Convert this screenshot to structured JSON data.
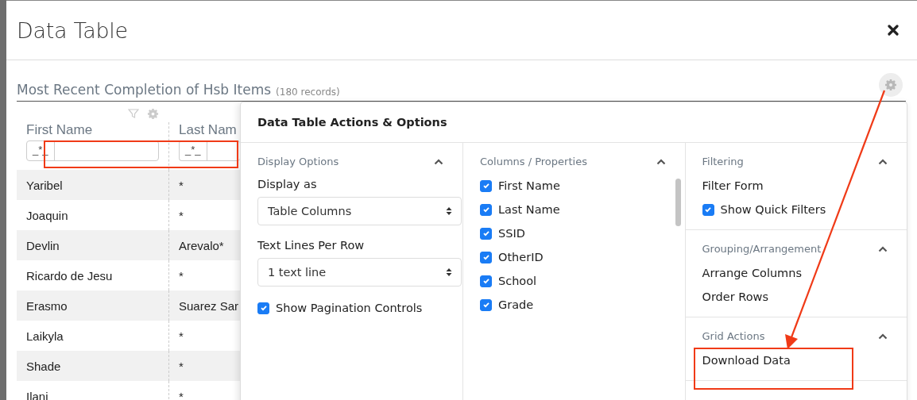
{
  "window": {
    "title": "Data Table"
  },
  "table": {
    "title": "Most Recent Completion of Hsb Items",
    "record_count": "(180 records)",
    "columns": [
      {
        "label": "First Name",
        "filter_prefix": "_*_"
      },
      {
        "label": "Last Nam",
        "filter_prefix": "_*_"
      }
    ],
    "rows": [
      {
        "cells": [
          "Yaribel",
          "*"
        ]
      },
      {
        "cells": [
          "Joaquin",
          "*"
        ]
      },
      {
        "cells": [
          "Devlin",
          "Arevalo*"
        ]
      },
      {
        "cells": [
          "Ricardo de Jesu",
          "*"
        ]
      },
      {
        "cells": [
          "Erasmo",
          "Suarez Sar"
        ]
      },
      {
        "cells": [
          "Laikyla",
          "*"
        ]
      },
      {
        "cells": [
          "Shade",
          "*"
        ]
      },
      {
        "cells": [
          "Ilani",
          "*"
        ]
      }
    ]
  },
  "options_panel": {
    "title": "Data Table Actions & Options",
    "columns": [
      [
        {
          "title": "Display Options",
          "expanded": true,
          "items": [
            {
              "kind": "label",
              "text": "Display as"
            },
            {
              "kind": "select",
              "value": "Table Columns"
            },
            {
              "kind": "label",
              "text": "Text Lines Per Row"
            },
            {
              "kind": "select",
              "value": "1 text line"
            },
            {
              "kind": "checkbox",
              "text": "Show Pagination Controls",
              "checked": true
            }
          ]
        }
      ],
      [
        {
          "title": "Columns / Properties",
          "expanded": true,
          "scroll": true,
          "items": [
            {
              "kind": "checkbox",
              "text": "First Name",
              "checked": true
            },
            {
              "kind": "checkbox",
              "text": "Last Name",
              "checked": true
            },
            {
              "kind": "checkbox",
              "text": "SSID",
              "checked": true
            },
            {
              "kind": "checkbox",
              "text": "OtherID",
              "checked": true
            },
            {
              "kind": "checkbox",
              "text": "School",
              "checked": true
            },
            {
              "kind": "checkbox",
              "text": "Grade",
              "checked": true
            }
          ]
        }
      ],
      [
        {
          "title": "Filtering",
          "expanded": true,
          "items": [
            {
              "kind": "action",
              "text": "Filter Form"
            },
            {
              "kind": "checkbox",
              "text": "Show Quick Filters",
              "checked": true
            }
          ]
        },
        {
          "title": "Grouping/Arrangement",
          "expanded": true,
          "items": [
            {
              "kind": "action",
              "text": "Arrange Columns"
            },
            {
              "kind": "action",
              "text": "Order Rows"
            }
          ]
        },
        {
          "title": "Grid Actions",
          "expanded": true,
          "items": [
            {
              "kind": "action",
              "text": "Download Data"
            }
          ]
        }
      ]
    ]
  }
}
